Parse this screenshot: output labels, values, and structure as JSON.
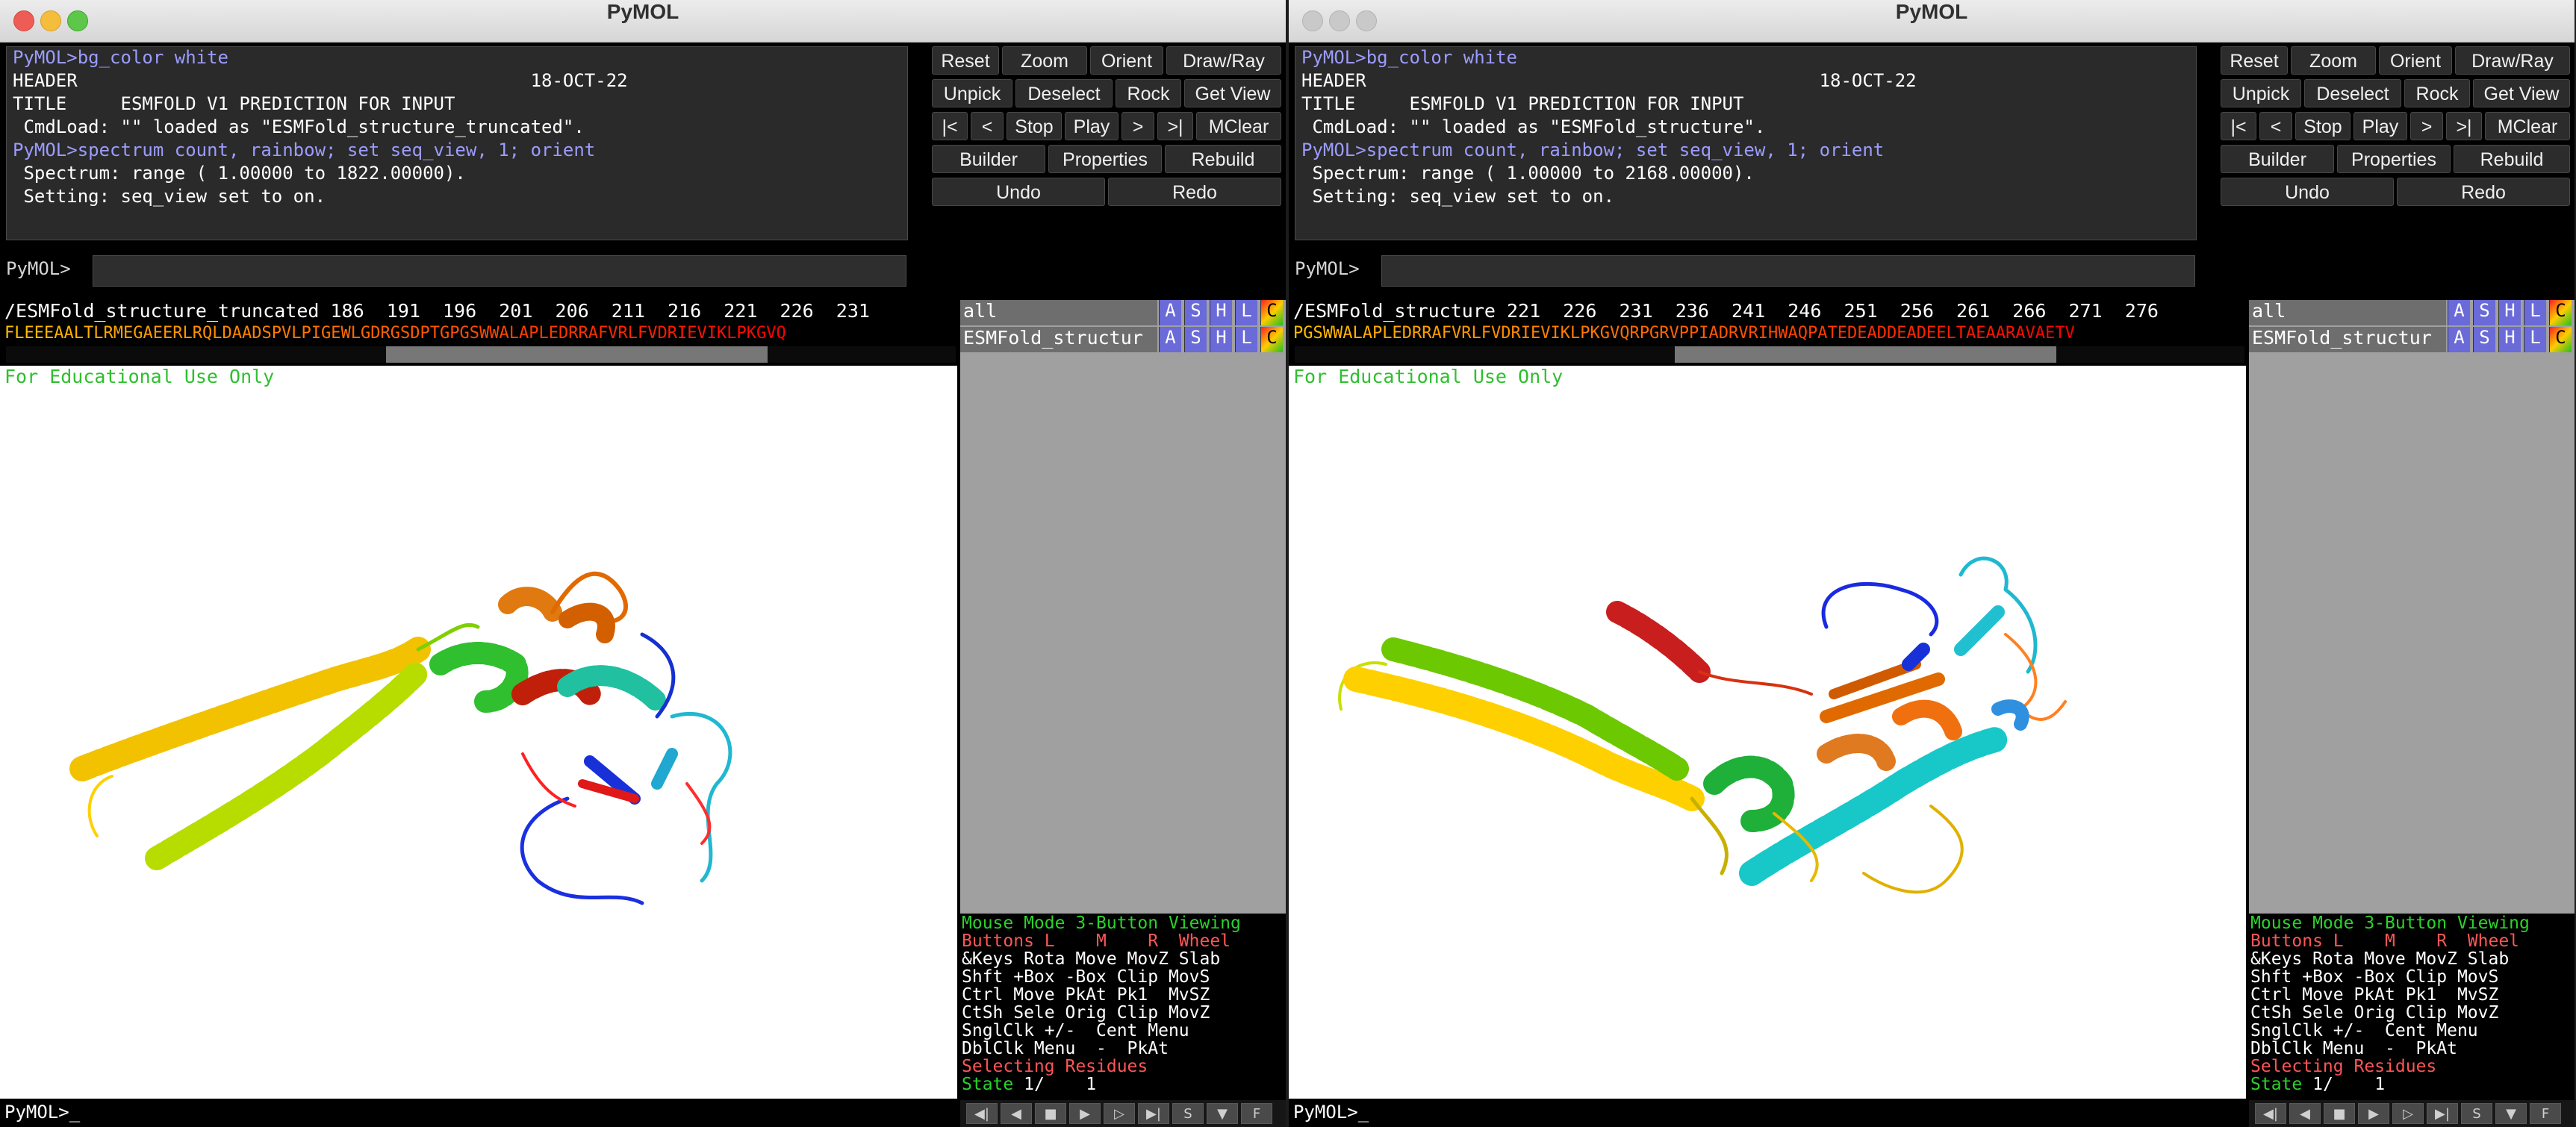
{
  "windows": [
    {
      "title": "PyMOL",
      "focused": true,
      "console_lines": [
        {
          "text": "PyMOL>bg_color white",
          "color": "#9c9cff"
        },
        {
          "text": "HEADER                                          18-OCT-22",
          "color": "#ffffff"
        },
        {
          "text": "TITLE     ESMFOLD V1 PREDICTION FOR INPUT",
          "color": "#ffffff"
        },
        {
          "text": " CmdLoad: \"\" loaded as \"ESMFold_structure_truncated\".",
          "color": "#ffffff"
        },
        {
          "text": "PyMOL>spectrum count, rainbow; set seq_view, 1; orient",
          "color": "#9c9cff"
        },
        {
          "text": " Spectrum: range ( 1.00000 to 1822.00000).",
          "color": "#ffffff"
        },
        {
          "text": " Setting: seq_view set to on.",
          "color": "#ffffff"
        }
      ],
      "prompt": "PyMOL>",
      "bottom_prompt": "PyMOL>_",
      "buttons": {
        "reset": "Reset",
        "zoom": "Zoom",
        "orient": "Orient",
        "drawray": "Draw/Ray",
        "unpick": "Unpick",
        "deselect": "Deselect",
        "rock": "Rock",
        "getview": "Get View",
        "first": "|<",
        "prev": "<",
        "stop": "Stop",
        "play": "Play",
        "next": ">",
        "last": ">|",
        "mclear": "MClear",
        "builder": "Builder",
        "properties": "Properties",
        "rebuild": "Rebuild",
        "undo": "Undo",
        "redo": "Redo"
      },
      "sequence_header": "/ESMFold_structure_truncated 186  191  196  201  206  211  216  221  226  231",
      "sequence_residues": "FLEEEAALTLRMEGAEERLRQLDAADSPVLPIGEWLGDRGSDPTGPGSWWALAPLEDRRAFVRLFVDRIEVIKLPKGVQ",
      "sequence_scroll_fraction": 0.33,
      "watermark": "For Educational Use Only",
      "objects": [
        {
          "name": "all",
          "buttons": [
            "A",
            "S",
            "H",
            "L",
            "C"
          ]
        },
        {
          "name": "ESMFold_structur",
          "buttons": [
            "A",
            "S",
            "H",
            "L",
            "C"
          ]
        }
      ],
      "mouse_mode": {
        "title": "Mouse Mode 3-Button Viewing",
        "buttons_row": "Buttons L    M    R  Wheel",
        "keys_row": "&Keys Rota Move MovZ Slab",
        "shft_row": "Shft +Box -Box Clip MovS",
        "ctrl_row": "Ctrl Move PkAt Pk1  MvSZ",
        "ctsh_row": "CtSh Sele Orig Clip MovZ",
        "sngl_row": "SnglClk +/-  Cent Menu",
        "dbl_row": "DblClk Menu  -  PkAt",
        "selecting": "Selecting Residues",
        "state_label": "State",
        "state_value": "1/    1"
      }
    },
    {
      "title": "PyMOL",
      "focused": false,
      "console_lines": [
        {
          "text": "PyMOL>bg_color white",
          "color": "#9c9cff"
        },
        {
          "text": "HEADER                                          18-OCT-22",
          "color": "#ffffff"
        },
        {
          "text": "TITLE     ESMFOLD V1 PREDICTION FOR INPUT",
          "color": "#ffffff"
        },
        {
          "text": " CmdLoad: \"\" loaded as \"ESMFold_structure\".",
          "color": "#ffffff"
        },
        {
          "text": "PyMOL>spectrum count, rainbow; set seq_view, 1; orient",
          "color": "#9c9cff"
        },
        {
          "text": " Spectrum: range ( 1.00000 to 2168.00000).",
          "color": "#ffffff"
        },
        {
          "text": " Setting: seq_view set to on.",
          "color": "#ffffff"
        }
      ],
      "prompt": "PyMOL>",
      "bottom_prompt": "PyMOL>_",
      "buttons": {
        "reset": "Reset",
        "zoom": "Zoom",
        "orient": "Orient",
        "drawray": "Draw/Ray",
        "unpick": "Unpick",
        "deselect": "Deselect",
        "rock": "Rock",
        "getview": "Get View",
        "first": "|<",
        "prev": "<",
        "stop": "Stop",
        "play": "Play",
        "next": ">",
        "last": ">|",
        "mclear": "MClear",
        "builder": "Builder",
        "properties": "Properties",
        "rebuild": "Rebuild",
        "undo": "Undo",
        "redo": "Redo"
      },
      "sequence_header": "/ESMFold_structure 221  226  231  236  241  246  251  256  261  266  271  276",
      "sequence_residues": "PGSWWALAPLEDRRAFVRLFVDRIEVIKLPKGVQRPGRVPPIADRVRIHWAQPATEDEADDEADEELTAEAARAVAETV",
      "sequence_scroll_fraction": 0.33,
      "watermark": "For Educational Use Only",
      "objects": [
        {
          "name": "all",
          "buttons": [
            "A",
            "S",
            "H",
            "L",
            "C"
          ]
        },
        {
          "name": "ESMFold_structur",
          "buttons": [
            "A",
            "S",
            "H",
            "L",
            "C"
          ]
        }
      ],
      "mouse_mode": {
        "title": "Mouse Mode 3-Button Viewing",
        "buttons_row": "Buttons L    M    R  Wheel",
        "keys_row": "&Keys Rota Move MovZ Slab",
        "shft_row": "Shft +Box -Box Clip MovS",
        "ctrl_row": "Ctrl Move PkAt Pk1  MvSZ",
        "ctsh_row": "CtSh Sele Orig Clip MovZ",
        "sngl_row": "SnglClk +/-  Cent Menu",
        "dbl_row": "DblClk Menu  -  PkAt",
        "selecting": "Selecting Residues",
        "state_label": "State",
        "state_value": "1/    1"
      }
    }
  ],
  "movie_controls": [
    "first-frame-icon",
    "prev-frame-icon",
    "stop-icon",
    "play-icon",
    "next-frame-icon",
    "last-frame-icon",
    "S",
    "record-icon",
    "F"
  ]
}
